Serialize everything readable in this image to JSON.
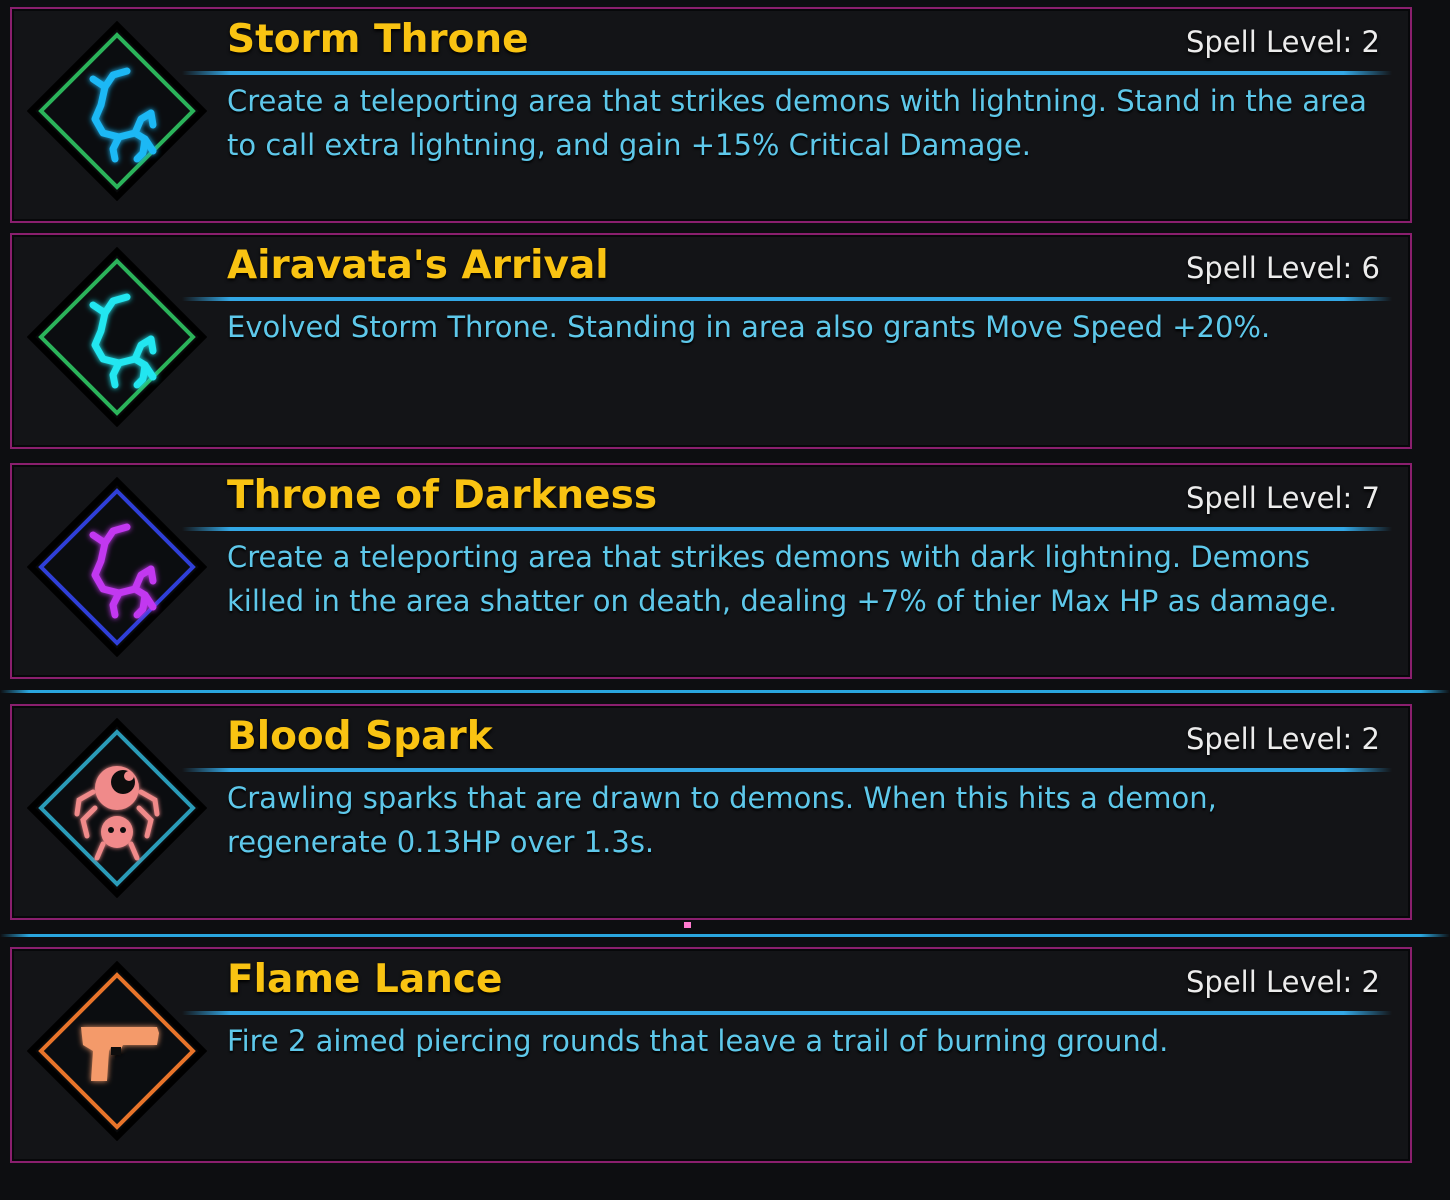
{
  "spells": [
    {
      "title": "Storm Throne",
      "level": "Spell Level: 2",
      "description": "Create a teleporting area that strikes demons with lightning. Stand in the area to call extra lightning, and gain +15% Critical Damage.",
      "icon": "storm-rune-icon",
      "frame_color": "#2bb35a",
      "glyph_color": "#1fb8f5"
    },
    {
      "title": "Airavata's Arrival",
      "level": "Spell Level: 6",
      "description": "Evolved Storm Throne. Standing in area also grants Move Speed +20%.",
      "icon": "storm-rune-icon",
      "frame_color": "#2bb35a",
      "glyph_color": "#22e6f0"
    },
    {
      "title": "Throne of Darkness",
      "level": "Spell Level: 7",
      "description": "Create a teleporting area that strikes demons with dark lightning. Demons killed in the area shatter on death, dealing +7% of thier Max HP as damage.",
      "icon": "dark-rune-icon",
      "frame_color": "#2f3fd8",
      "glyph_color": "#c238f0"
    },
    {
      "title": "Blood Spark",
      "level": "Spell Level: 2",
      "description": "Crawling sparks that are drawn to demons. When this hits a demon, regenerate 0.13HP over 1.3s.",
      "icon": "spider-spark-icon",
      "frame_color": "#2a9bb8",
      "glyph_color": "#f08a8a"
    },
    {
      "title": "Flame Lance",
      "level": "Spell Level: 2",
      "description": "Fire 2 aimed piercing rounds that leave a trail of burning ground.",
      "icon": "pistol-icon",
      "frame_color": "#e8742a",
      "glyph_color": "#f49a6a"
    }
  ],
  "colors": {
    "card_border": "#8a1f6e",
    "title": "#f9c312",
    "description": "#5ec8ea",
    "separator": "#2aa6de"
  }
}
